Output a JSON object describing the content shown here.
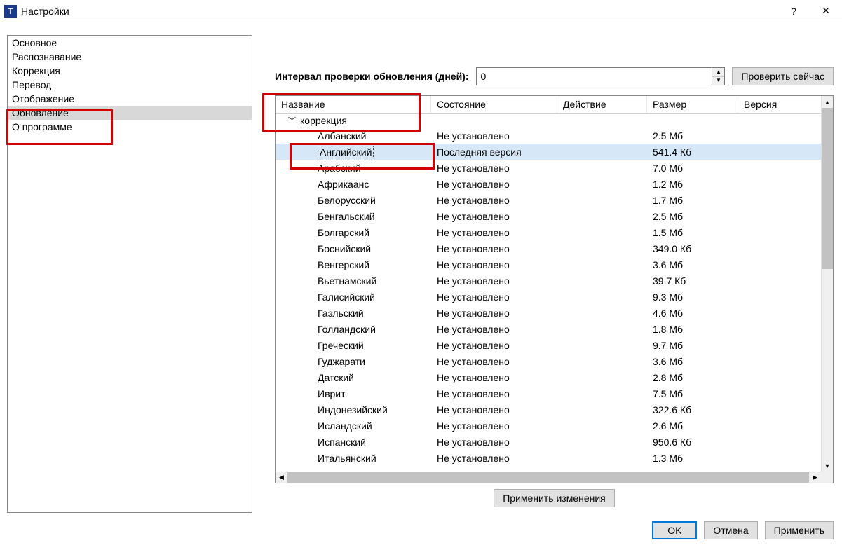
{
  "window": {
    "title": "Настройки",
    "help": "?",
    "close": "✕"
  },
  "sidebar": {
    "items": [
      {
        "label": "Основное"
      },
      {
        "label": "Распознавание"
      },
      {
        "label": "Коррекция"
      },
      {
        "label": "Перевод"
      },
      {
        "label": "Отображение"
      },
      {
        "label": "Обновление",
        "selected": true
      },
      {
        "label": "О программе"
      }
    ]
  },
  "toprow": {
    "label": "Интервал проверки обновления (дней):",
    "value": "0",
    "check_button": "Проверить сейчас"
  },
  "table": {
    "columns": {
      "name": "Название",
      "state": "Состояние",
      "action": "Действие",
      "size": "Размер",
      "version": "Версия"
    },
    "group": "коррекция",
    "rows": [
      {
        "name": "Албанский",
        "state": "Не установлено",
        "size": "2.5 Мб"
      },
      {
        "name": "Английский",
        "state": "Последняя версия",
        "size": "541.4 Кб",
        "selected": true
      },
      {
        "name": "Арабский",
        "state": "Не установлено",
        "size": "7.0 Мб"
      },
      {
        "name": "Африкаанс",
        "state": "Не установлено",
        "size": "1.2 Мб"
      },
      {
        "name": "Белорусский",
        "state": "Не установлено",
        "size": "1.7 Мб"
      },
      {
        "name": "Бенгальский",
        "state": "Не установлено",
        "size": "2.5 Мб"
      },
      {
        "name": "Болгарский",
        "state": "Не установлено",
        "size": "1.5 Мб"
      },
      {
        "name": "Боснийский",
        "state": "Не установлено",
        "size": "349.0 Кб"
      },
      {
        "name": "Венгерский",
        "state": "Не установлено",
        "size": "3.6 Мб"
      },
      {
        "name": "Вьетнамский",
        "state": "Не установлено",
        "size": "39.7 Кб"
      },
      {
        "name": "Галисийский",
        "state": "Не установлено",
        "size": "9.3 Мб"
      },
      {
        "name": "Гаэльский",
        "state": "Не установлено",
        "size": "4.6 Мб"
      },
      {
        "name": "Голландский",
        "state": "Не установлено",
        "size": "1.8 Мб"
      },
      {
        "name": "Греческий",
        "state": "Не установлено",
        "size": "9.7 Мб"
      },
      {
        "name": "Гуджарати",
        "state": "Не установлено",
        "size": "3.6 Мб"
      },
      {
        "name": "Датский",
        "state": "Не установлено",
        "size": "2.8 Мб"
      },
      {
        "name": "Иврит",
        "state": "Не установлено",
        "size": "7.5 Мб"
      },
      {
        "name": "Индонезийский",
        "state": "Не установлено",
        "size": "322.6 Кб"
      },
      {
        "name": "Исландский",
        "state": "Не установлено",
        "size": "2.6 Мб"
      },
      {
        "name": "Испанский",
        "state": "Не установлено",
        "size": "950.6 Кб"
      },
      {
        "name": "Итальянский",
        "state": "Не установлено",
        "size": "1.3 Мб"
      }
    ]
  },
  "buttons": {
    "apply_changes": "Применить изменения",
    "ok": "OK",
    "cancel": "Отмена",
    "apply": "Применить"
  }
}
